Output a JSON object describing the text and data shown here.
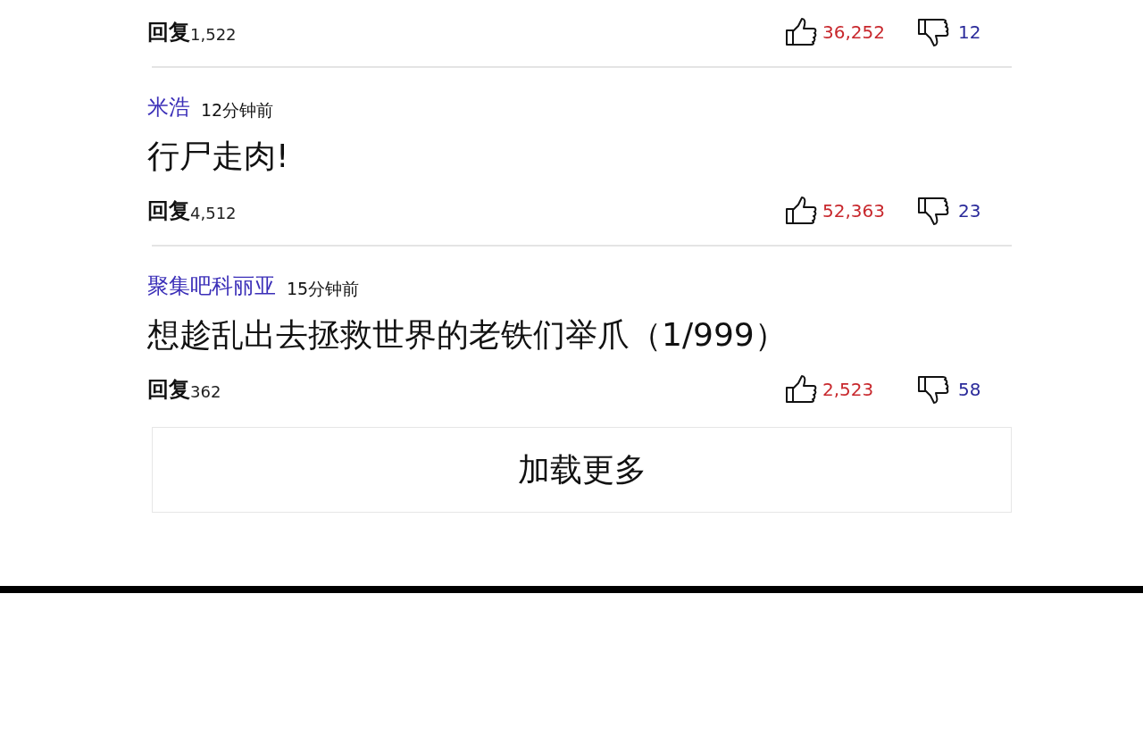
{
  "comments": [
    {
      "reply_label": "回复",
      "reply_count": "1,522",
      "likes": "36,252",
      "dislikes": "12"
    },
    {
      "user": "米浩",
      "time": "12分钟前",
      "text": "行尸走肉!",
      "reply_label": "回复",
      "reply_count": "4,512",
      "likes": "52,363",
      "dislikes": "23"
    },
    {
      "user": "聚集吧科丽亚",
      "time": "15分钟前",
      "text": "想趁乱出去拯救世界的老铁们举爪（1/999）",
      "reply_label": "回复",
      "reply_count": "362",
      "likes": "2,523",
      "dislikes": "58"
    }
  ],
  "load_more": "加载更多"
}
